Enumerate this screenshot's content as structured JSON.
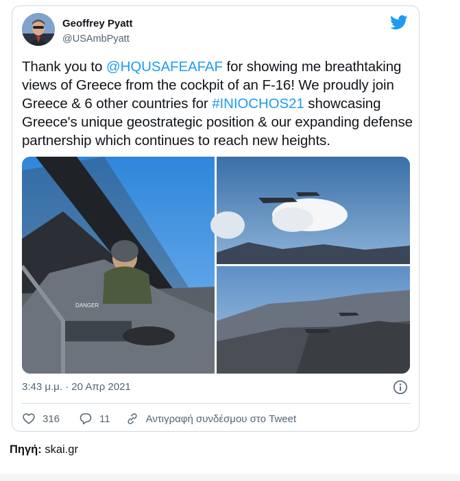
{
  "tweet": {
    "author_name": "Geoffrey Pyatt",
    "author_handle": "@USAmbPyatt",
    "text_parts": {
      "p1": "Thank you to ",
      "mention": "@HQUSAFEAFAF",
      "p2": " for showing me breathtaking views of Greece from the cockpit of an F-16! We proudly join Greece & 6 other countries for ",
      "hashtag": "#INIOCHOS21",
      "p3": " showcasing Greece's unique geostrategic position & our expanding defense partnership which continues to reach new heights."
    },
    "timestamp": "3:43 μ.μ. · 20 Απρ 2021",
    "likes": "316",
    "replies": "11",
    "copy_link_label": "Αντιγραφή συνδέσμου στο Tweet",
    "colors": {
      "link": "#1d9bf0",
      "text": "#0f1419",
      "muted": "#536471",
      "border": "#cfd9de"
    },
    "icons": [
      "twitter-bird-icon",
      "info-icon",
      "heart-icon",
      "reply-bubble-icon",
      "link-chain-icon"
    ]
  },
  "source": {
    "label": "Πηγή:",
    "value": "skai.gr"
  }
}
